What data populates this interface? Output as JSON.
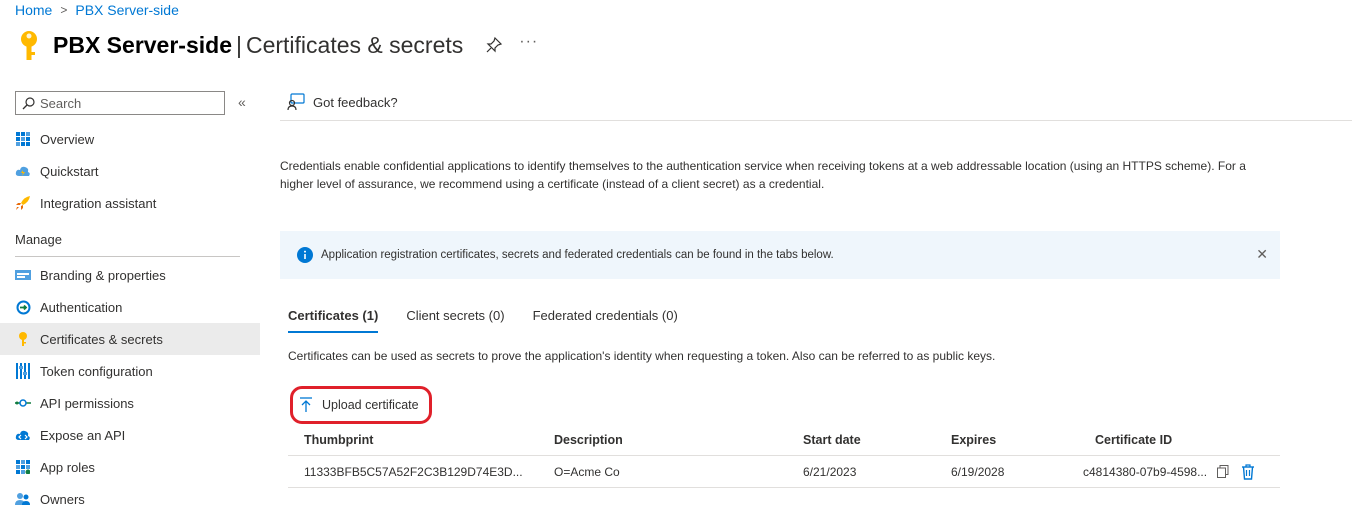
{
  "breadcrumb": {
    "home": "Home",
    "separator": ">",
    "current": "PBX Server-side"
  },
  "title": {
    "app": "PBX Server-side",
    "divider": "|",
    "page": "Certificates & secrets",
    "more": "···"
  },
  "sidebar": {
    "search_placeholder": "Search",
    "collapse_glyph": "«",
    "items_top": [
      {
        "label": "Overview",
        "icon": "grid-icon"
      },
      {
        "label": "Quickstart",
        "icon": "cloud-lightning-icon"
      },
      {
        "label": "Integration assistant",
        "icon": "rocket-icon"
      }
    ],
    "section": "Manage",
    "items_manage": [
      {
        "label": "Branding & properties",
        "icon": "branding-icon"
      },
      {
        "label": "Authentication",
        "icon": "authentication-icon"
      },
      {
        "label": "Certificates & secrets",
        "icon": "key-icon",
        "active": true
      },
      {
        "label": "Token configuration",
        "icon": "token-bars-icon"
      },
      {
        "label": "API permissions",
        "icon": "api-permissions-icon"
      },
      {
        "label": "Expose an API",
        "icon": "cloud-icon"
      },
      {
        "label": "App roles",
        "icon": "app-roles-icon"
      },
      {
        "label": "Owners",
        "icon": "owners-icon"
      }
    ]
  },
  "main": {
    "feedback": "Got feedback?",
    "description": "Credentials enable confidential applications to identify themselves to the authentication service when receiving tokens at a web addressable location (using an HTTPS scheme). For a higher level of assurance, we recommend using a certificate (instead of a client secret) as a credential.",
    "info_banner": "Application registration certificates, secrets and federated credentials can be found in the tabs below.",
    "tabs": [
      {
        "label": "Certificates (1)",
        "active": true
      },
      {
        "label": "Client secrets (0)"
      },
      {
        "label": "Federated credentials (0)"
      }
    ],
    "tab_description": "Certificates can be used as secrets to prove the application's identity when requesting a token. Also can be referred to as public keys.",
    "upload_label": "Upload certificate",
    "table": {
      "headers": [
        "Thumbprint",
        "Description",
        "Start date",
        "Expires",
        "Certificate ID"
      ],
      "rows": [
        {
          "thumbprint": "11333BFB5C57A52F2C3B129D74E3D...",
          "description": "O=Acme Co",
          "start_date": "6/21/2023",
          "expires": "6/19/2028",
          "certificate_id": "c4814380-07b9-4598..."
        }
      ]
    }
  },
  "colors": {
    "accent": "#0078d4",
    "highlight": "#e0202a",
    "key": "#ffb900",
    "info_bg": "#eff6fc"
  }
}
